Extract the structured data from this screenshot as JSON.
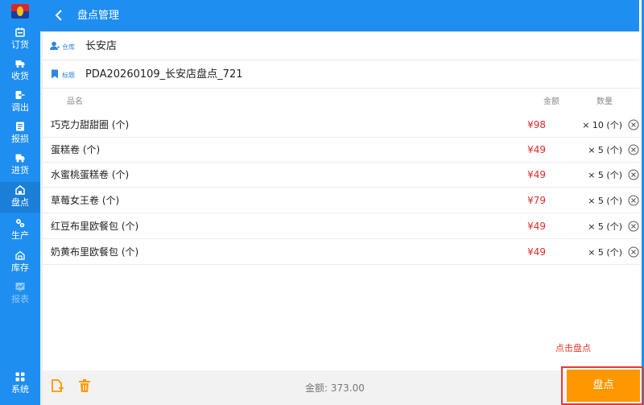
{
  "header": {
    "title": "盘点管理"
  },
  "sidebar": {
    "items": [
      {
        "label": "订货",
        "icon": "calendar-icon"
      },
      {
        "label": "收货",
        "icon": "truck-icon"
      },
      {
        "label": "调出",
        "icon": "transfer-out-icon"
      },
      {
        "label": "报损",
        "icon": "report-loss-icon"
      },
      {
        "label": "进货",
        "icon": "delivery-icon"
      },
      {
        "label": "盘点",
        "icon": "inventory-check-icon"
      },
      {
        "label": "生产",
        "icon": "gears-icon"
      },
      {
        "label": "库存",
        "icon": "warehouse-icon"
      },
      {
        "label": "报表",
        "icon": "chart-icon"
      },
      {
        "label": "系统",
        "icon": "grid-icon"
      }
    ],
    "active": "盘点"
  },
  "info": {
    "store_label": "仓库",
    "store_value": "长安店",
    "title_label": "标题",
    "title_value": "PDA20260109_长安店盘点_721"
  },
  "table": {
    "headers": {
      "name": "品名",
      "amount": "金额",
      "qty": "数量"
    },
    "rows": [
      {
        "name": "巧克力甜甜圈 (个)",
        "price": "¥98",
        "qty": "× 10 (个)"
      },
      {
        "name": "蛋糕卷 (个)",
        "price": "¥49",
        "qty": "× 5 (个)"
      },
      {
        "name": "水蜜桃蛋糕卷 (个)",
        "price": "¥49",
        "qty": "× 5 (个)"
      },
      {
        "name": "草莓女王卷 (个)",
        "price": "¥79",
        "qty": "× 5 (个)"
      },
      {
        "name": "红豆布里欧餐包 (个)",
        "price": "¥49",
        "qty": "× 5 (个)"
      },
      {
        "name": "奶黄布里欧餐包 (个)",
        "price": "¥49",
        "qty": "× 5 (个)"
      }
    ]
  },
  "hint": "点击盘点",
  "footer": {
    "total": "金额: 373.00",
    "submit": "盘点"
  },
  "colors": {
    "primary": "#1e8ef0",
    "accent": "#ff9800",
    "price": "#e02b2b",
    "highlight": "#e53935"
  }
}
